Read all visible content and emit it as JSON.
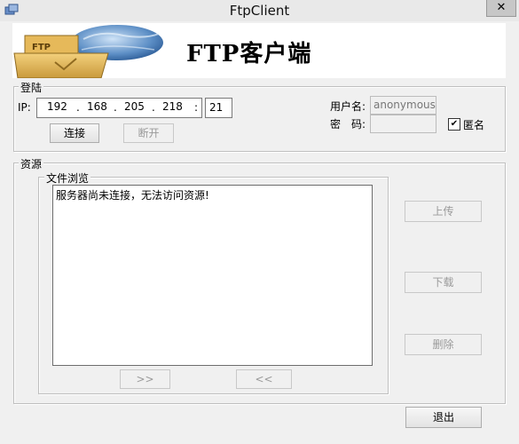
{
  "window": {
    "title": "FtpClient",
    "close_glyph": "✕"
  },
  "banner": {
    "title": "FTP客户端",
    "logo_text": "FTP"
  },
  "login": {
    "group_label": "登陆",
    "ip_label": "IP:",
    "ip_octets": [
      "192",
      "168",
      "205",
      "218"
    ],
    "ip_dot": ".",
    "port_sep": ":",
    "port": "21",
    "username_label": "用户名:",
    "username_value": "anonymous",
    "password_label": "密　码:",
    "password_value": "",
    "anonymous_label": "匿名",
    "anonymous_checked": "✔",
    "connect_label": "连接",
    "disconnect_label": "断开"
  },
  "resources": {
    "group_label": "资源",
    "browse_label": "文件浏览",
    "message": "服务器尚未连接，无法访问资源!",
    "forward_label": ">>",
    "back_label": "<<",
    "upload_label": "上传",
    "download_label": "下载",
    "delete_label": "删除"
  },
  "footer": {
    "exit_label": "退出"
  }
}
